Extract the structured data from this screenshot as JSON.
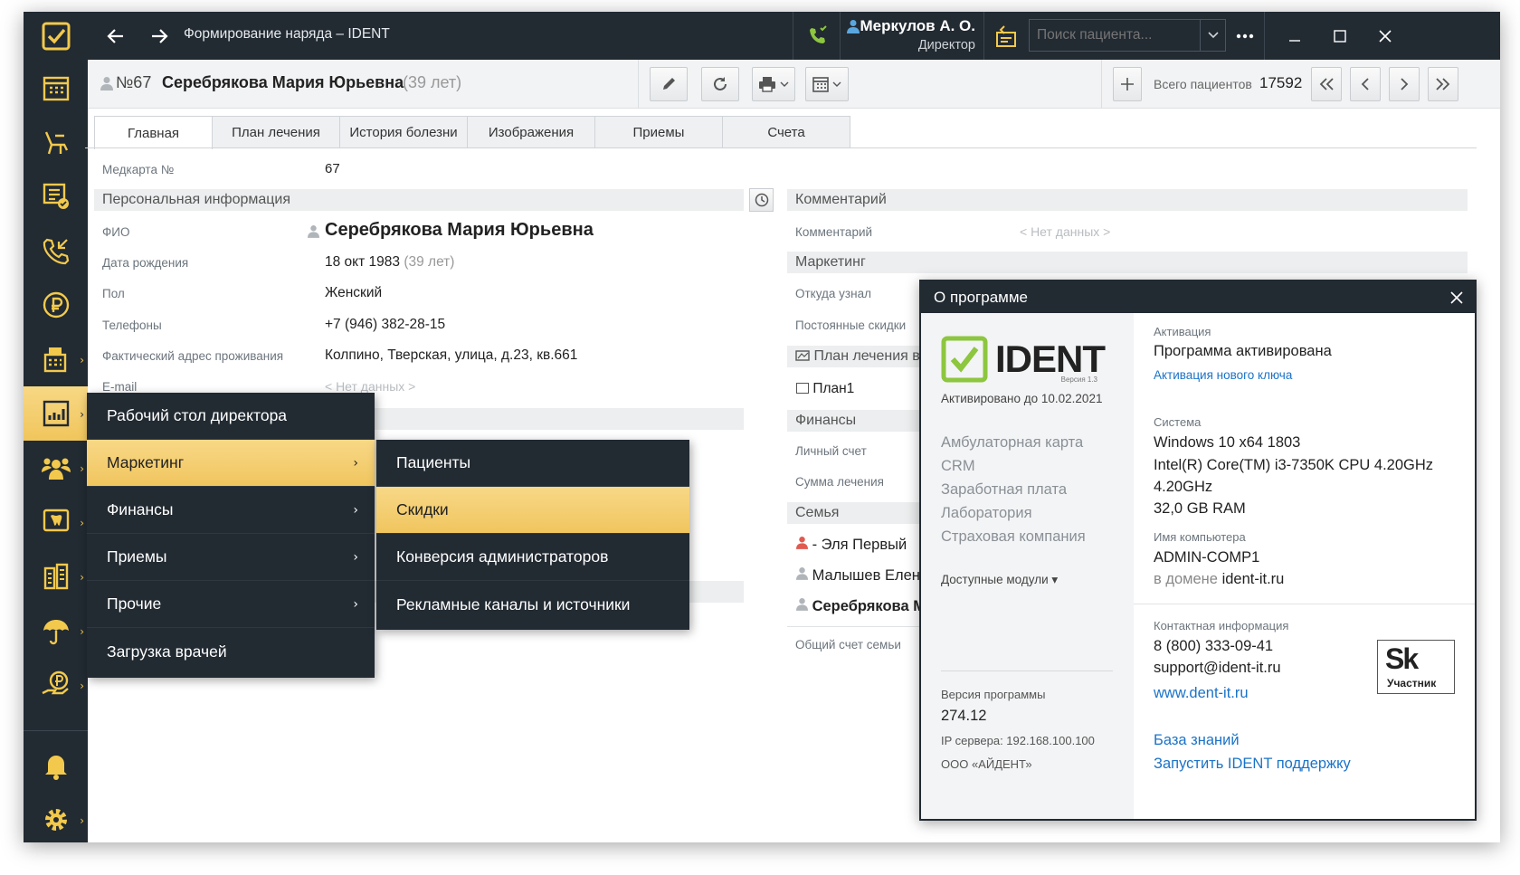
{
  "window": {
    "title": "Формирование наряда – IDENT"
  },
  "user": {
    "name": "Меркулов А. О.",
    "role": "Директор"
  },
  "search": {
    "placeholder": "Поиск пациента..."
  },
  "patient": {
    "number": "№67",
    "name": "Серебрякова Мария Юрьевна",
    "age": "(39 лет)"
  },
  "toolbar": {
    "total_label": "Всего пациентов",
    "total_value": "17592"
  },
  "tabs": [
    "Главная",
    "План лечения",
    "История болезни",
    "Изображения",
    "Приемы",
    "Счета"
  ],
  "main": {
    "medcard_label": "Медкарта №",
    "medcard_value": "67",
    "personal_header": "Персональная информация",
    "fio_label": "ФИО",
    "fio_value": "Серебрякова Мария Юрьевна",
    "dob_label": "Дата рождения",
    "dob_value": "18 окт 1983",
    "dob_age": "(39 лет)",
    "sex_label": "Пол",
    "sex_value": "Женский",
    "phone_label": "Телефоны",
    "phone_value": "+7 (946) 382-28-15",
    "address_label": "Фактический адрес проживания",
    "address_value": "Колпино, Тверская, улица, д.23, кв.661",
    "email_label": "E-mail",
    "email_value": "< Нет данных >"
  },
  "right": {
    "comment_header": "Комментарий",
    "comment_label": "Комментарий",
    "comment_value": "< Нет данных >",
    "marketing_header": "Маркетинг",
    "source_label": "Откуда узнал",
    "discounts_label": "Постоянные скидки",
    "plan_header": "План лечения в",
    "plan_item": "План1",
    "finance_header": "Финансы",
    "account_label": "Личный счет",
    "treatment_sum_label": "Сумма лечения",
    "family_header": "Семья",
    "family": [
      "- Эля Первый",
      "Малышев Елен",
      "Серебрякова М"
    ],
    "family_total_label": "Общий счет семьи"
  },
  "menu": {
    "items": [
      "Рабочий стол директора",
      "Маркетинг",
      "Финансы",
      "Приемы",
      "Прочие",
      "Загрузка врачей"
    ],
    "chevron": "›",
    "submenu": [
      "Пациенты",
      "Скидки",
      "Конверсия администраторов",
      "Рекламные каналы и источники"
    ]
  },
  "about": {
    "title": "О программе",
    "logo_text": "IDENT",
    "logo_version": "Версия 1.3",
    "activated_until": "Активировано до 10.02.2021",
    "modules": [
      "Амбулаторная карта",
      "CRM",
      "Заработная плата",
      "Лаборатория",
      "Страховая компания"
    ],
    "modules_dropdown": "Доступные модули ▾",
    "version_label": "Версия программы",
    "version_value": "274.12",
    "server_ip": "IP сервера: 192.168.100.100",
    "company": "ООО «АЙДЕНТ»",
    "activation_label": "Активация",
    "activation_value": "Программа активирована",
    "activation_link": "Активация нового ключа",
    "system_label": "Система",
    "system_os": "Windows 10 x64 1803",
    "system_cpu": "Intel(R) Core(TM) i3-7350K CPU 4.20GHz",
    "system_cpu2": "4.20GHz",
    "system_ram": "32,0 GB RAM",
    "computer_label": "Имя компьютера",
    "computer_name": "ADMIN-COMP1",
    "domain_prefix": "в домене",
    "domain": "ident-it.ru",
    "contact_label": "Контактная информация",
    "phone": "8 (800) 333-09-41",
    "email": "support@ident-it.ru",
    "site": "www.dent-it.ru",
    "kb_link": "База знаний",
    "support_link": "Запустить IDENT поддержку",
    "sk_logo": "Sk",
    "sk_label": "Участник"
  },
  "colors": {
    "dark": "#222a32",
    "accent": "#f2c94c",
    "link": "#1a73c8",
    "green": "#8dc63f"
  }
}
